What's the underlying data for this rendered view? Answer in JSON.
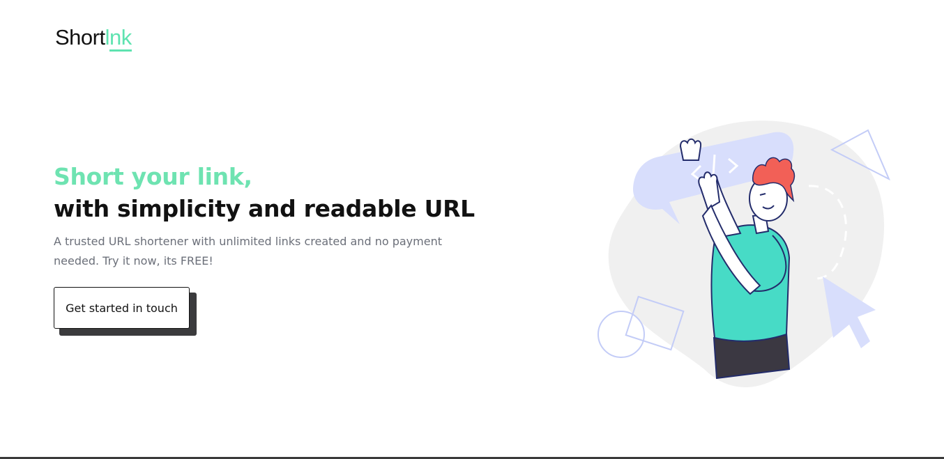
{
  "brand": {
    "logo_part1": "Short",
    "logo_part2": "l",
    "logo_part3": "nk",
    "accent_color": "#5ee3b0"
  },
  "hero": {
    "title_accent": "Short your link,",
    "title": "with simplicity and readable URL",
    "description": "A trusted URL shortener with unlimited links created and no payment needed. Try it now, its FREE!",
    "cta_label": "Get started in touch"
  },
  "illustration": {
    "icon": "person-with-code-bubble-illustration"
  }
}
